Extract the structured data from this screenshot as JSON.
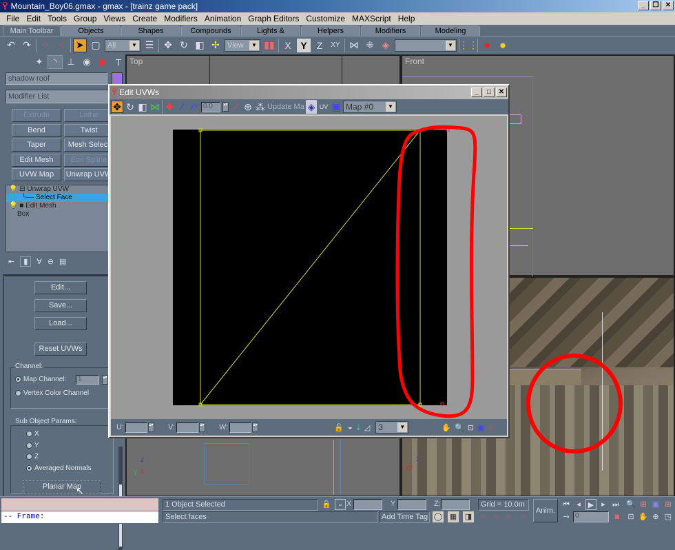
{
  "window": {
    "title": "Mountain_Boy06.gmax - gmax - [trainz game pack]",
    "app_icon": "gmax-icon",
    "controls": {
      "minimize": "_",
      "restore": "❐",
      "close": "✕"
    }
  },
  "menubar": {
    "items": [
      "File",
      "Edit",
      "Tools",
      "Group",
      "Views",
      "Create",
      "Modifiers",
      "Animation",
      "Graph Editors",
      "Customize",
      "MAXScript",
      "Help"
    ]
  },
  "tabs": {
    "items": [
      "Main Toolbar",
      "Objects",
      "Shapes",
      "Compounds",
      "Lights & Cameras",
      "Helpers",
      "Modifiers",
      "Modeling"
    ],
    "active": "Main Toolbar"
  },
  "toolbar": {
    "selection_filter": "All",
    "reference_coord": "View",
    "named_selection": "",
    "axis_constraints": [
      "X",
      "Y",
      "Z",
      "XY"
    ],
    "active_axis": "Y"
  },
  "command_panel": {
    "object_name": "shadow roof",
    "object_color": "#a070e0",
    "modifier_list_label": "Modifier List",
    "modifier_buttons": [
      {
        "label": "Extrude",
        "enabled": false
      },
      {
        "label": "Lathe",
        "enabled": false
      },
      {
        "label": "Bend",
        "enabled": true
      },
      {
        "label": "Twist",
        "enabled": true
      },
      {
        "label": "Taper",
        "enabled": true
      },
      {
        "label": "Mesh Select",
        "enabled": true
      },
      {
        "label": "Edit Mesh",
        "enabled": true
      },
      {
        "label": "Edit Spline",
        "enabled": false
      },
      {
        "label": "UVW Map",
        "enabled": true
      },
      {
        "label": "Unwrap UVW",
        "enabled": true
      }
    ],
    "stack": [
      {
        "label": "Unwrap UVW",
        "type": "modifier",
        "selected": false
      },
      {
        "label": "Select Face",
        "type": "subobject",
        "selected": true
      },
      {
        "label": "Edit Mesh",
        "type": "modifier",
        "selected": false
      },
      {
        "label": "Box",
        "type": "base",
        "selected": false
      }
    ],
    "params": {
      "edit_button": "Edit...",
      "save_button": "Save...",
      "load_button": "Load...",
      "reset_button": "Reset UVWs",
      "channel_group": "Channel:",
      "map_channel_label": "Map Channel:",
      "map_channel_value": "1",
      "vertex_color_label": "Vertex Color Channel",
      "channel_selected": "Map Channel",
      "subobject_group": "Sub Object Params:",
      "subobject_options": [
        "X",
        "Y",
        "Z",
        "Averaged Normals"
      ],
      "subobject_selected": "Averaged Normals",
      "planar_map_button": "Planar Map"
    }
  },
  "viewports": {
    "top_label": "Top",
    "front_label": "Front",
    "perspective_label": "",
    "axes": {
      "x": "x",
      "y": "y",
      "z": "z"
    }
  },
  "edit_uvw": {
    "title": "Edit UVWs",
    "spinner_value": "0.0",
    "update_map_label": "Update Map",
    "map_dropdown": "Map #0",
    "u_label": "U:",
    "v_label": "V:",
    "w_label": "W:",
    "u_value": "",
    "v_value": "",
    "w_value": "",
    "zoom_dropdown": "3",
    "colors": {
      "edge": "#d8d840",
      "selected_vertex": "#ff2040",
      "background": "#000000",
      "annotation": "#ff0000"
    }
  },
  "status": {
    "listener_text": "-- Frame:",
    "selection_info": "1 Object Selected",
    "prompt": "Select faces",
    "x_label": "X",
    "y_label": "Y",
    "z_label": "Z:",
    "x_value": "",
    "y_value": "",
    "z_value": "",
    "grid": "Grid = 10.0m",
    "add_time_tag": "Add Time Tag",
    "anim_button": "Anim.",
    "frame_value": "0"
  }
}
